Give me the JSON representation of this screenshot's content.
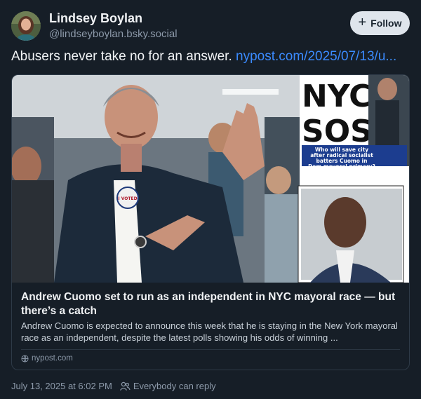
{
  "author": {
    "display_name": "Lindsey Boylan",
    "handle": "@lindseyboylan.bsky.social"
  },
  "follow_button": {
    "label": "Follow",
    "icon": "plus-icon"
  },
  "post": {
    "text": "Abusers never take no for an answer. ",
    "link_text": "nypost.com/2025/07/13/u..."
  },
  "embed": {
    "title": "Andrew Cuomo set to run as an independent in NYC mayoral race — but there’s a catch",
    "description": "Andrew Cuomo is expected to announce this week that he is staying in the New York mayoral race as an independent, despite the latest polls showing his odds of winning ...",
    "domain": "nypost.com",
    "image": {
      "newspaper_headline": "NYC SOS",
      "newspaper_headline_line1": "NYC",
      "newspaper_headline_line2": "SOS",
      "newspaper_subtext": [
        "Who will save city",
        "after radical socialist",
        "batters Cuomo in",
        "Dem mayoral primary?"
      ],
      "badge_text": "I VOTED"
    }
  },
  "meta": {
    "timestamp": "July 13, 2025 at 6:02 PM",
    "reply_setting": "Everybody can reply"
  },
  "colors": {
    "background": "#161e27",
    "link": "#3b8bff",
    "muted": "#8d9aaa",
    "follow_bg": "#dfe5ec"
  }
}
